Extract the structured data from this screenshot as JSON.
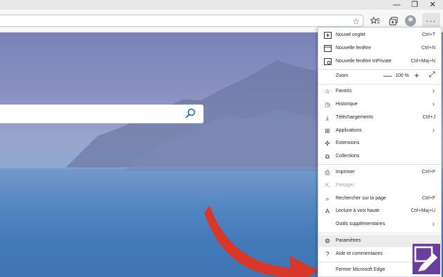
{
  "window": {
    "minimize": "—",
    "maximize": "❐",
    "close": "✕"
  },
  "toolbar": {
    "more_label": "···"
  },
  "menu": {
    "items": [
      {
        "label": "Nouvel onglet",
        "shortcut": "Ctrl+T",
        "icon": "new-tab-icon"
      },
      {
        "label": "Nouvelle fenêtre",
        "shortcut": "Ctrl+N",
        "icon": "new-window-icon"
      },
      {
        "label": "Nouvelle fenêtre InPrivate",
        "shortcut": "Ctrl+Maj+N",
        "icon": "inprivate-icon"
      },
      {
        "label": "Favoris",
        "icon": "star-icon"
      },
      {
        "label": "Historique",
        "icon": "history-icon"
      },
      {
        "label": "Téléchargements",
        "shortcut": "Ctrl+J",
        "icon": "download-icon"
      },
      {
        "label": "Applications",
        "icon": "apps-icon"
      },
      {
        "label": "Extensions",
        "icon": "puzzle-icon"
      },
      {
        "label": "Collections",
        "icon": "collections-icon"
      },
      {
        "label": "Imprimer",
        "shortcut": "Ctrl+P",
        "icon": "printer-icon"
      },
      {
        "label": "Partager",
        "icon": "share-icon",
        "disabled": true
      },
      {
        "label": "Rechercher sur la page",
        "shortcut": "Ctrl+F",
        "icon": "find-icon"
      },
      {
        "label": "Lecture à voix haute",
        "shortcut": "Ctrl+Maj+U",
        "icon": "read-aloud-icon"
      },
      {
        "label": "Outils supplémentaires",
        "icon": ""
      },
      {
        "label": "Paramètres",
        "icon": "gear-icon",
        "highlighted": true
      },
      {
        "label": "Aide et commentaires",
        "icon": "help-icon"
      },
      {
        "label": "Fermer Microsoft Edge",
        "icon": ""
      }
    ],
    "zoom": {
      "label": "Zoom",
      "minus": "—",
      "value": "100 %",
      "plus": "+",
      "fullscreen": "⤢"
    }
  },
  "colors": {
    "arrow": "#d8382a",
    "menu_highlight": "#ececec",
    "logo": "#6a3e9e"
  }
}
